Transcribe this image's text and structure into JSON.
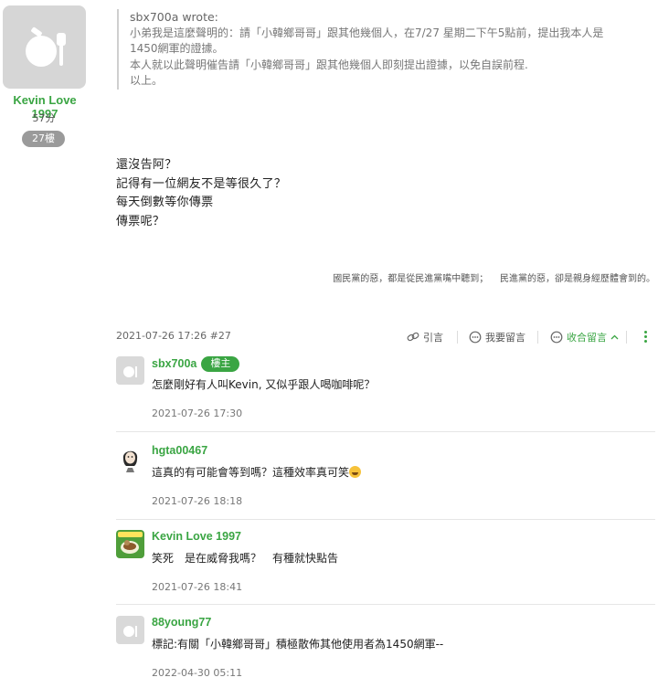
{
  "author": {
    "name": "Kevin Love 1997",
    "score": "57分",
    "floor": "27樓"
  },
  "quote": {
    "who": "sbx700a wrote:",
    "lines": [
      "小弟我是這麼聲明的：請「小韓鄉哥哥」跟其他幾個人，在7/27 星期二下午5點前，提出我本人是",
      "1450網軍的證據。",
      "本人就以此聲明催告請「小韓鄉哥哥」跟其他幾個人即刻提出證據，以免自誤前程.",
      "以上。"
    ]
  },
  "post": {
    "lines": [
      "還沒告阿？",
      "記得有一位網友不是等很久了？",
      "每天倒數等你傳票",
      "傳票呢？"
    ],
    "signature": "國民黨的惡，都是從民進黨嘴中聽到；    民進黨的惡，卻是親身經歷體會到的。"
  },
  "meta": {
    "date": "2021-07-26 17:26 #27",
    "quote_label": "引言",
    "reply_label": "我要留言",
    "collapse_label": "收合留言"
  },
  "comments": [
    {
      "user": "sbx700a",
      "badge": "樓主",
      "text": "怎麼剛好有人叫Kevin, 又似乎跟人喝咖啡呢？",
      "time": "2021-07-26 17:30"
    },
    {
      "user": "hgta00467",
      "text": "這真的有可能會等到嗎？這種效率真可笑",
      "time": "2021-07-26 18:18"
    },
    {
      "user": "Kevin Love 1997",
      "text": "笑死　是在威脅我嗎？　有種就快點告",
      "time": "2021-07-26 18:41"
    },
    {
      "user": "88young77",
      "text": "標記:有關「小韓鄉哥哥」積極散佈其他使用者為1450網軍--",
      "time": "2022-04-30 05:11"
    }
  ],
  "colors": {
    "accent": "#3aa543",
    "badge_gray": "#9a9a9a"
  }
}
